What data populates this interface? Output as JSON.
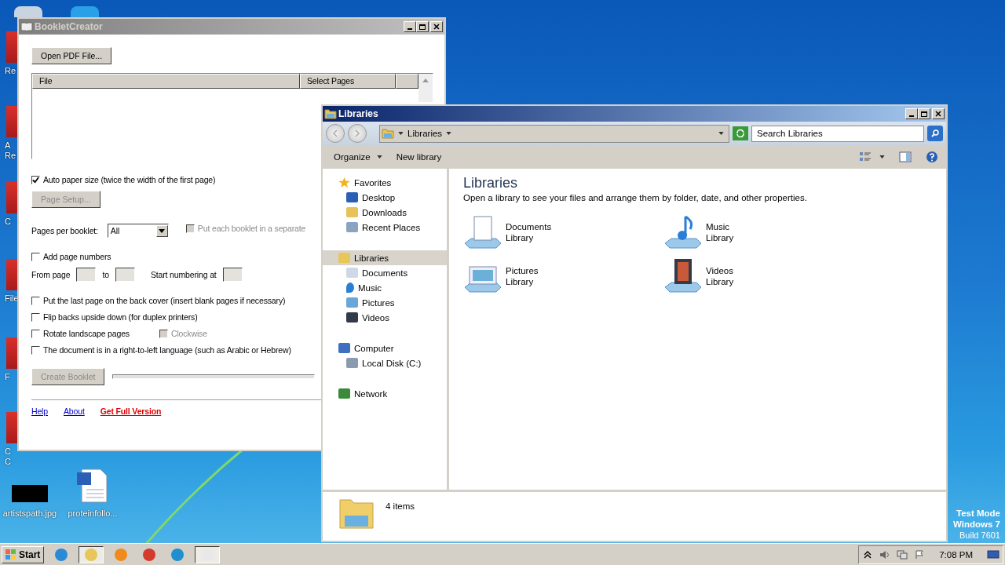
{
  "desktop": {
    "edge_icons": [
      {
        "lines": [
          "Re"
        ]
      },
      {
        "lines": [
          "A",
          "Re"
        ]
      },
      {
        "lines": [
          "C"
        ]
      },
      {
        "lines": [
          "File"
        ]
      },
      {
        "lines": [
          "F"
        ]
      },
      {
        "lines": [
          "C",
          "C"
        ]
      }
    ],
    "icons": [
      {
        "label": "artistspath.jpg",
        "kind": "image"
      },
      {
        "label": "proteinfollo...",
        "kind": "document"
      }
    ],
    "test_mode": [
      "Test Mode",
      "Windows 7",
      "Build 7601"
    ]
  },
  "booklet_window": {
    "title": "BookletCreator",
    "active": false,
    "open_button": "Open PDF File...",
    "table": {
      "columns": [
        "File",
        "Select Pages",
        ""
      ]
    },
    "auto_paper": {
      "label": "Auto paper size (twice the width of the first page)",
      "checked": true
    },
    "page_setup": {
      "label": "Page Setup...",
      "disabled": true
    },
    "pages_per_booklet": {
      "label": "Pages per booklet:",
      "value": "All"
    },
    "separate_file": {
      "label": "Put each booklet in a separate",
      "checked": false,
      "disabled": true
    },
    "add_numbers": {
      "label": "Add page numbers",
      "checked": false
    },
    "numbering": {
      "from_label": "From page",
      "to_label": "to",
      "start_label": "Start numbering at"
    },
    "options": [
      {
        "label": "Put the last page on the back cover (insert blank pages if necessary)",
        "checked": false
      },
      {
        "label": "Flip backs upside down (for duplex printers)",
        "checked": false
      },
      {
        "label": "Rotate landscape pages",
        "checked": false,
        "sub": {
          "label": "Clockwise",
          "checked": false,
          "disabled": true
        }
      },
      {
        "label": "The document is in a right-to-left language (such as Arabic or Hebrew)",
        "checked": false
      }
    ],
    "create_button": {
      "label": "Create Booklet",
      "disabled": true
    },
    "progress": {
      "level": 0
    },
    "links": [
      {
        "label": "Help",
        "kind": "plain"
      },
      {
        "label": "About",
        "kind": "plain"
      },
      {
        "label": "Get Full Version",
        "kind": "promo"
      }
    ]
  },
  "explorer_window": {
    "title": "Libraries",
    "active": true,
    "address": "Libraries",
    "search": {
      "placeholder": "Search Libraries"
    },
    "toolbar": [
      {
        "label": "Organize",
        "dropdown": true
      },
      {
        "label": "New library",
        "dropdown": false
      }
    ],
    "sidebar": [
      {
        "label": "Favorites",
        "kind": "star",
        "selected": false,
        "children": [
          {
            "label": "Desktop",
            "kind": "desktop",
            "selected": false
          },
          {
            "label": "Downloads",
            "kind": "downloads",
            "selected": false
          },
          {
            "label": "Recent Places",
            "kind": "recent",
            "selected": false
          }
        ]
      },
      {
        "label": "Libraries",
        "kind": "libraries",
        "selected": true,
        "children": [
          {
            "label": "Documents",
            "kind": "documents",
            "selected": false
          },
          {
            "label": "Music",
            "kind": "music",
            "selected": false
          },
          {
            "label": "Pictures",
            "kind": "pictures",
            "selected": false
          },
          {
            "label": "Videos",
            "kind": "videos",
            "selected": false
          }
        ]
      },
      {
        "label": "Computer",
        "kind": "computer",
        "selected": false,
        "children": [
          {
            "label": "Local Disk (C:)",
            "kind": "disk",
            "selected": false
          }
        ]
      },
      {
        "label": "Network",
        "kind": "network",
        "selected": false
      }
    ],
    "heading": "Libraries",
    "description": "Open a library to see your files and arrange them by folder, date, and other properties.",
    "libraries": [
      {
        "name": "Documents",
        "type": "Library",
        "kind": "documents"
      },
      {
        "name": "Music",
        "type": "Library",
        "kind": "music"
      },
      {
        "name": "Pictures",
        "type": "Library",
        "kind": "pictures"
      },
      {
        "name": "Videos",
        "type": "Library",
        "kind": "videos"
      }
    ],
    "status": "4 items"
  },
  "taskbar": {
    "start": "Start",
    "apps": [
      {
        "kind": "ie",
        "selected": false
      },
      {
        "kind": "explorer",
        "selected": true
      },
      {
        "kind": "media",
        "selected": false
      },
      {
        "kind": "chrome",
        "selected": false
      },
      {
        "kind": "edge",
        "selected": false
      },
      {
        "kind": "booklet",
        "selected": true
      }
    ],
    "clock": "7:08 PM"
  }
}
